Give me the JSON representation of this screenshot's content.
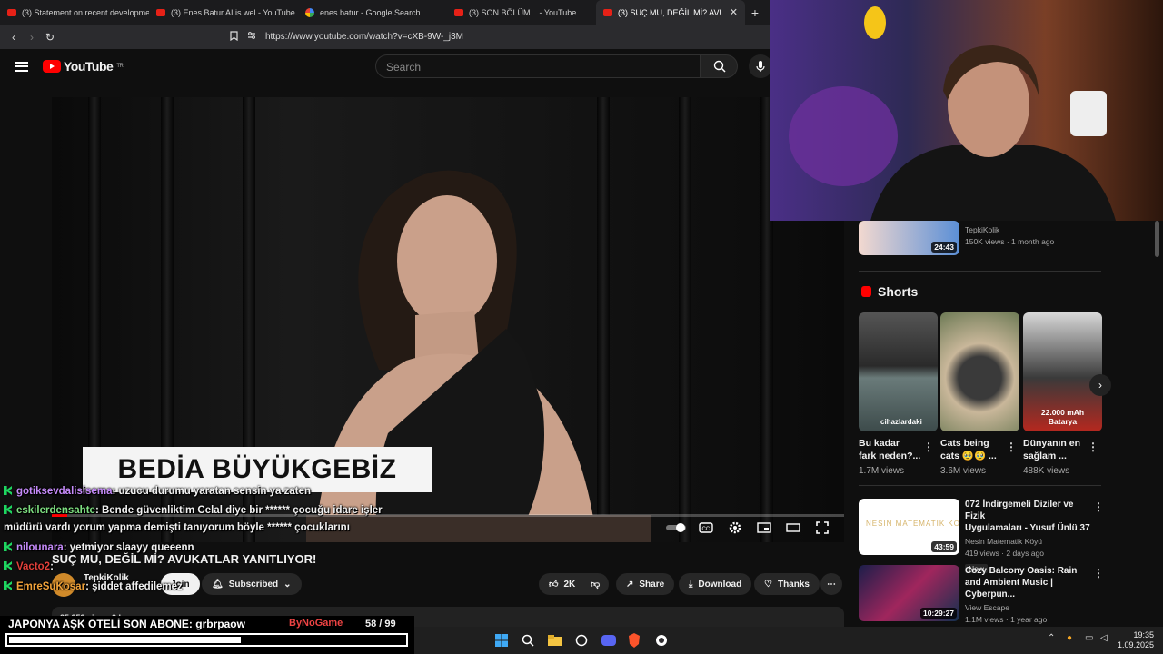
{
  "browser": {
    "tabs": [
      {
        "label": "(3) Statement on recent developmen",
        "icon": "youtube-favicon"
      },
      {
        "label": "(3) Enes Batur AI is wel - YouTube",
        "icon": "youtube-favicon"
      },
      {
        "label": "enes batur - Google Search",
        "icon": "google-favicon"
      },
      {
        "label": "(3) SON BÖLÜM... - YouTube",
        "icon": "youtube-favicon"
      },
      {
        "label": "(3) SUÇ MU, DEĞİL Mİ? AVUKATI",
        "icon": "youtube-favicon",
        "active": true
      }
    ],
    "url": "https://www.youtube.com/watch?v=cXB-9W-_j3M"
  },
  "youtube": {
    "logo": "YouTube",
    "region": "TR",
    "search_placeholder": "Search"
  },
  "video": {
    "lower_third": "BEDİA BÜYÜKGEBİZ",
    "progress_fraction": 0.02,
    "title": "SUÇ MU, DEĞİL Mİ? AVUKATLAR YANITLIYOR!",
    "channel": "TepkiKolik",
    "join_label": "Join",
    "subscribed_label": "Subscribed",
    "likes": "2K",
    "share_label": "Share",
    "download_label": "Download",
    "thanks_label": "Thanks",
    "description_meta": "25.253 views  2 hours ago"
  },
  "chat": [
    {
      "user": "gotiksevdalisisema",
      "user_color": "#c58af9",
      "text": ": uzucu durumu yaratan sensin ya zaten"
    },
    {
      "user": "eskilerdensahte",
      "user_color": "#7ee081",
      "text": ": Bende güvenliktim Celal diye bir ****** çocuğu idare işler"
    },
    {
      "user": "",
      "user_color": "#ffffff",
      "text": "müdürü vardı yorum yapma demişti tanıyorum böyle ****** çocuklarını"
    },
    {
      "user": "nilounara",
      "user_color": "#c58af9",
      "text": ": yetmiyor slaayy queeenn"
    },
    {
      "user": "Vacto2",
      "user_color": "#e0403a",
      "text": ":"
    },
    {
      "user": "EmreSuKosar",
      "user_color": "#f2a33a",
      "text": ": şiddet affedilemez"
    }
  ],
  "sidebar": {
    "top_card": {
      "channel": "TepkiKolik",
      "meta": "150K views · 1 month ago",
      "duration": "24:43"
    },
    "shorts_heading": "Shorts",
    "shorts": [
      {
        "title_line1": "Bu kadar",
        "title_line2": "fark neden?...",
        "views": "1.7M views",
        "thumb_text": "cihazlardaki"
      },
      {
        "title_line1": "Cats being",
        "title_line2": "cats 🥹🥹 ...",
        "views": "3.6M views",
        "thumb_text": ""
      },
      {
        "title_line1": "Dünyanın en",
        "title_line2": "sağlam ...",
        "views": "488K views",
        "thumb_text": "22.000 mAh Batarya"
      }
    ],
    "videos": [
      {
        "title_line1": "072 İndirgemeli Diziler ve Fizik",
        "title_line2": "Uygulamaları - Yusuf Ünlü 37",
        "channel": "Nesin Matematik Köyü",
        "meta": "419 views · 2 days ago",
        "badge": "New",
        "duration": "43:59",
        "thumb_text": "NESİN MATEMATİK KÖYÜ"
      },
      {
        "title_line1": "Cozy Balcony Oasis: Rain",
        "title_line2": "and Ambient Music | Cyberpun...",
        "channel": "View Escape",
        "meta": "1.1M views · 1 year ago",
        "duration": "10:29:27"
      }
    ]
  },
  "overlay": {
    "ticker": "JAPONYA AŞK OTELİ    SON ABONE: grbrpaow",
    "game_label": "ByNoGame",
    "counter": "58  / 99",
    "goal_fraction": 0.59
  },
  "taskbar": {
    "time": "19:35",
    "date": "1.09.2025"
  },
  "colors": {
    "accent_red": "#ff0000",
    "background": "#0f0f0f"
  }
}
